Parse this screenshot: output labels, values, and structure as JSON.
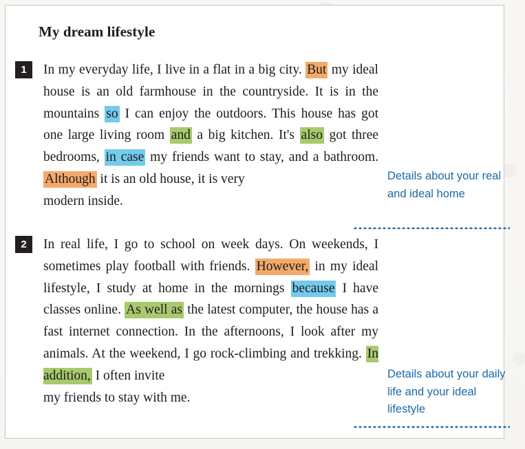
{
  "worksheet": {
    "title": "My dream lifestyle",
    "paragraphs": [
      {
        "number": "1",
        "text": "In my everyday life, I live in a flat in a big city. But my ideal house is an old farmhouse in the countryside. It is in the mountains so I can enjoy the outdoors. This house has got one large living room and a big kitchen. It's also got three bedrooms, in case my friends want to stay, and a bathroom. Although it is an old house, it is very modern inside.",
        "segments": [
          {
            "text": "In my everyday life, I live in a flat in a big city. ",
            "highlight": "none"
          },
          {
            "text": "But",
            "highlight": "orange"
          },
          {
            "text": " my ideal house is an old farmhouse in the countryside. It is in the mountains ",
            "highlight": "none"
          },
          {
            "text": "so",
            "highlight": "blue"
          },
          {
            "text": " I can enjoy the outdoors. This house has got one large living room ",
            "highlight": "none"
          },
          {
            "text": "and",
            "highlight": "green"
          },
          {
            "text": " a big kitchen. It's ",
            "highlight": "none"
          },
          {
            "text": "also",
            "highlight": "green"
          },
          {
            "text": " got three bedrooms, ",
            "highlight": "none"
          },
          {
            "text": "in case",
            "highlight": "blue"
          },
          {
            "text": " my friends want to stay, and a bathroom. ",
            "highlight": "none"
          },
          {
            "text": "Although",
            "highlight": "orange"
          },
          {
            "text": " it is an old house, it is very ",
            "highlight": "none"
          },
          {
            "text": "modern inside.",
            "highlight": "none",
            "lastline": true
          }
        ]
      },
      {
        "number": "2",
        "text": "In real life, I go to school on week days. On weekends, I sometimes play football with friends. However, in my ideal lifestyle, I study at home in the mornings because I have classes online. As well as the latest computer, the house has a fast internet connection. In the afternoons, I look after my animals. At the weekend, I go rock-climbing and trekking. In addition, I often invite my friends to stay with me.",
        "segments": [
          {
            "text": "In real life, I go to school on week days. On weekends, I sometimes play football with friends. ",
            "highlight": "none"
          },
          {
            "text": "However,",
            "highlight": "orange"
          },
          {
            "text": " in my ideal lifestyle, I study at home in the mornings ",
            "highlight": "none"
          },
          {
            "text": "because",
            "highlight": "blue"
          },
          {
            "text": " I have classes online. ",
            "highlight": "none"
          },
          {
            "text": "As well as",
            "highlight": "green"
          },
          {
            "text": " the latest computer, the house has a fast internet connection. In the afternoons, I look after my animals. At the weekend, I go rock-climbing and trekking. ",
            "highlight": "none"
          },
          {
            "text": "In addition,",
            "highlight": "green"
          },
          {
            "text": " I often invite ",
            "highlight": "none"
          },
          {
            "text": "my friends to stay with me.",
            "highlight": "none",
            "lastline": true
          }
        ]
      }
    ],
    "annotations": [
      {
        "text": "Details about your real and ideal home"
      },
      {
        "text": "Details about your daily life and your ideal lifestyle"
      }
    ]
  },
  "colors": {
    "highlight_orange": "#f4a96a",
    "highlight_blue": "#73cbec",
    "highlight_green": "#a9c96e",
    "annotation_blue": "#1a6aa8",
    "badge_background": "#231f20",
    "badge_text": "#ffffff",
    "page_background": "#f7f6f3",
    "card_background": "#ffffff",
    "body_text": "#1c1c1c"
  }
}
